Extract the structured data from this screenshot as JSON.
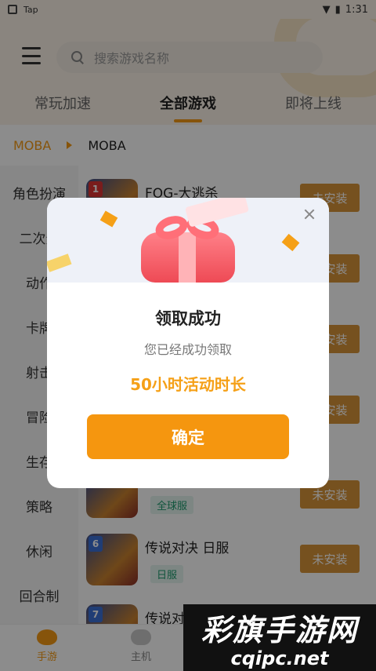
{
  "statusbar": {
    "app_label": "Tap",
    "time": "1:31"
  },
  "search": {
    "placeholder": "搜索游戏名称"
  },
  "tabs": [
    {
      "label": "常玩加速"
    },
    {
      "label": "全部游戏"
    },
    {
      "label": "即将上线"
    }
  ],
  "breadcrumb": {
    "parent": "MOBA",
    "current": "MOBA"
  },
  "sidebar": {
    "items": [
      {
        "label": "角色扮演"
      },
      {
        "label": "二次元"
      },
      {
        "label": "动作"
      },
      {
        "label": "卡牌"
      },
      {
        "label": "射击"
      },
      {
        "label": "冒险"
      },
      {
        "label": "生存"
      },
      {
        "label": "策略"
      },
      {
        "label": "休闲"
      },
      {
        "label": "回合制"
      }
    ]
  },
  "games": [
    {
      "rank": "1",
      "title": "FOG-大逃杀",
      "tag": "",
      "button": "未安装"
    },
    {
      "rank": "",
      "title": "",
      "tag": "全球服",
      "button": "未安装"
    },
    {
      "rank": "6",
      "title": "传说对决 日服",
      "tag": "日服",
      "button": "未安装"
    },
    {
      "rank": "7",
      "title": "传说对",
      "tag": "",
      "button": ""
    }
  ],
  "bottomnav": [
    {
      "label": "手游",
      "icon": "game-face-icon"
    },
    {
      "label": "主机",
      "icon": "gamepad-icon"
    }
  ],
  "dialog": {
    "title": "领取成功",
    "subtitle": "您已经成功领取",
    "reward": "50小时活动时长",
    "confirm_label": "确定"
  },
  "watermark": {
    "line1": "彩旗手游网",
    "line2": "cqipc.net"
  },
  "colors": {
    "accent": "#f59a14",
    "button": "#d8943a",
    "tag_green": "#1e9a6e"
  }
}
